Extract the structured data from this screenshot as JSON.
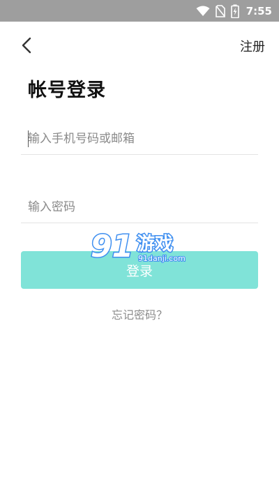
{
  "status_bar": {
    "time": "7:55",
    "icons": [
      "wifi-icon",
      "no-sim-icon",
      "battery-charging-icon"
    ]
  },
  "header": {
    "back_icon": "chevron-left-icon",
    "register_label": "注册"
  },
  "title": "帐号登录",
  "form": {
    "phone_placeholder": "输入手机号码或邮箱",
    "password_placeholder": "输入密码",
    "login_label": "登录"
  },
  "forgot_password_label": "忘记密码？",
  "watermark": {
    "logo_number": "91",
    "logo_text": "游戏",
    "logo_url": "91danji.com"
  },
  "colors": {
    "status_bar": "#9e9e9e",
    "login_button": "#80e3d8",
    "watermark_blue": "#3f8ff0"
  }
}
